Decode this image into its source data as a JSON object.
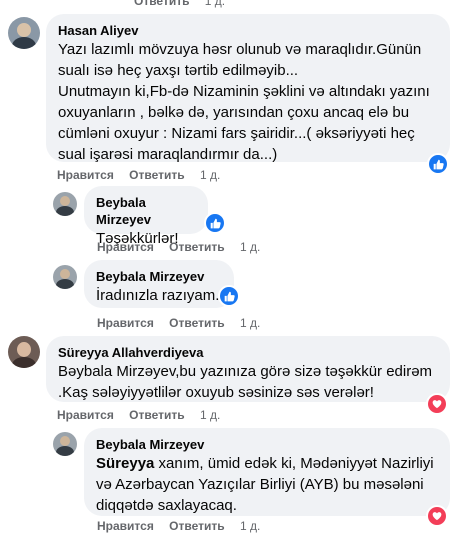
{
  "top": {
    "reply_label": "Ответить",
    "time": "1 д."
  },
  "comments": [
    {
      "author": "Hasan Aliyev",
      "text": "Yazı lazımlı mövzuya həsr olunub və maraqlıdır.Günün sualı isə heç yaxşı tərtib edilməyib...\nUnutmayın ki,Fb-də Nizaminin şəklini və altındakı yazını oxuyanların , bəlkə də, yarısından çoxu ancaq elə bu cümləni oxuyur : Nizami fars şairidir...( əksəriyyəti heç sual işarəsi maraqlandırmır da...)",
      "like_label": "Нравится",
      "reply_label": "Ответить",
      "time": "1 д.",
      "reaction": "like",
      "avatar_color": "#4a5a6b"
    },
    {
      "author": "Beybala Mirzeyev",
      "text": "Təşəkkürlər!",
      "like_label": "Нравится",
      "reply_label": "Ответить",
      "time": "1 д.",
      "reaction": "like",
      "avatar_color": "#5c6670"
    },
    {
      "author": "Beybala Mirzeyev",
      "text": "İradınızla razıyam.",
      "like_label": "Нравится",
      "reply_label": "Ответить",
      "time": "1 д.",
      "reaction": "like",
      "avatar_color": "#5c6670"
    },
    {
      "author": "Süreyya Allahverdiyeva",
      "text": "Bəybala Mirzəyev,bu yazınıza görə sizə təşəkkür edirəm .Kaş sələyiyyətlilər oxuyub səsinizə səs verələr!",
      "like_label": "Нравится",
      "reply_label": "Ответить",
      "time": "1 д.",
      "reaction": "love",
      "avatar_color": "#6b5a55"
    },
    {
      "author": "Beybala Mirzeyev",
      "mention": "Süreyya",
      "text": " xanım, ümid edək ki, Mədəniyyət Nazirliyi və Azərbaycan Yazıçılar Birliyi (AYB) bu məsələni diqqətdə saxlayacaq.",
      "like_label": "Нравится",
      "reply_label": "Ответить",
      "time": "1 д.",
      "reaction": "love",
      "avatar_color": "#5c6670"
    }
  ],
  "colors": {
    "like": "#1877f2",
    "love": "#f33e58",
    "bubble": "#f0f2f5",
    "meta": "#65676b"
  },
  "icons": {
    "like": "thumbs-up-icon",
    "love": "heart-icon"
  }
}
